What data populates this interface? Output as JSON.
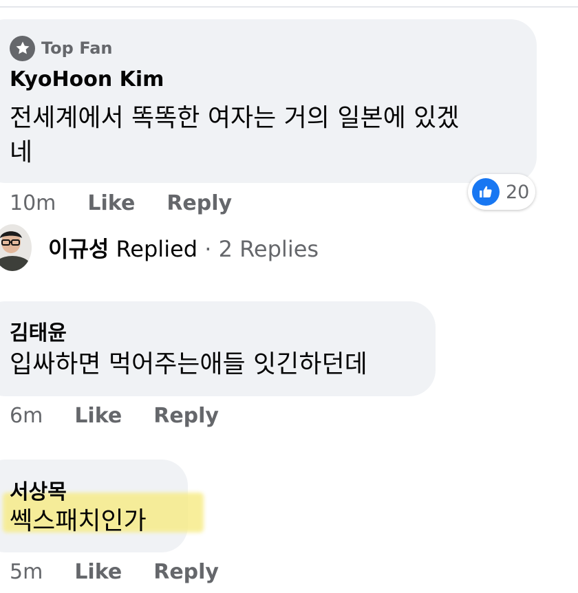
{
  "comment1": {
    "badge": "Top Fan",
    "badge_icon": "star-icon",
    "author": "KyoHoon Kim",
    "text_line1": "전세계에서 똑똑한 여자는 거의 일본에 있겠",
    "text_line2": "네",
    "time": "10m",
    "like_label": "Like",
    "reply_label": "Reply",
    "reaction_icon": "thumbs-up-icon",
    "reaction_count": "20",
    "reaction_color": "#1877f2"
  },
  "replies_summary": {
    "name": "이규성",
    "action": "Replied",
    "separator": "·",
    "count": "2 Replies"
  },
  "comment2": {
    "author": "김태윤",
    "text": "입싸하면 먹어주는애들 잇긴하던데",
    "time": "6m",
    "like_label": "Like",
    "reply_label": "Reply"
  },
  "comment3": {
    "author": "서상목",
    "text": "쎅스패치인가",
    "time": "5m",
    "like_label": "Like",
    "reply_label": "Reply",
    "highlight_color": "#f7ec8a"
  },
  "colors": {
    "bubble": "#f0f2f5",
    "secondary_text": "#65676b",
    "primary_text": "#050505"
  }
}
